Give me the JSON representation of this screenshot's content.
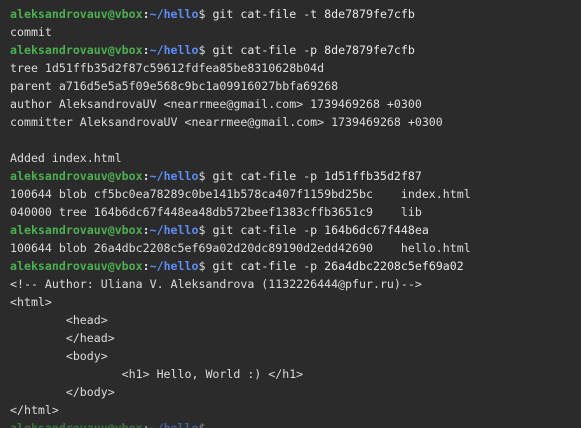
{
  "prompt": {
    "user_host": "aleksandrovauv@vbox",
    "colon": ":",
    "path": "~/hello",
    "dollar": "$ "
  },
  "lines": [
    {
      "type": "cmd",
      "text": "git cat-file -t 8de7879fe7cfb"
    },
    {
      "type": "out",
      "text": "commit"
    },
    {
      "type": "cmd",
      "text": "git cat-file -p 8de7879fe7cfb"
    },
    {
      "type": "out",
      "text": "tree 1d51ffb35d2f87c59612fdfea85be8310628b04d"
    },
    {
      "type": "out",
      "text": "parent a716d5e5a5f09e568c9bc1a09916027bbfa69268"
    },
    {
      "type": "out",
      "text": "author AleksandrovaUV <nearrmee@gmail.com> 1739469268 +0300"
    },
    {
      "type": "out",
      "text": "committer AleksandrovaUV <nearrmee@gmail.com> 1739469268 +0300"
    },
    {
      "type": "out",
      "text": ""
    },
    {
      "type": "out",
      "text": "Added index.html"
    },
    {
      "type": "cmd",
      "text": "git cat-file -p 1d51ffb35d2f87"
    },
    {
      "type": "out",
      "text": "100644 blob cf5bc0ea78289c0be141b578ca407f1159bd25bc    index.html"
    },
    {
      "type": "out",
      "text": "040000 tree 164b6dc67f448ea48db572beef1383cffb3651c9    lib"
    },
    {
      "type": "cmd",
      "text": "git cat-file -p 164b6dc67f448ea"
    },
    {
      "type": "out",
      "text": "100644 blob 26a4dbc2208c5ef69a02d20dc89190d2edd42690    hello.html"
    },
    {
      "type": "cmd",
      "text": "git cat-file -p 26a4dbc2208c5ef69a02"
    },
    {
      "type": "out",
      "text": "<!-- Author: Uliana V. Aleksandrova (1132226444@pfur.ru)-->"
    },
    {
      "type": "out",
      "text": "<html>"
    },
    {
      "type": "out",
      "text": "        <head>"
    },
    {
      "type": "out",
      "text": "        </head>"
    },
    {
      "type": "out",
      "text": "        <body>"
    },
    {
      "type": "out",
      "text": "                <h1> Hello, World :) </h1>"
    },
    {
      "type": "out",
      "text": "        </body>"
    },
    {
      "type": "out",
      "text": "</html>"
    },
    {
      "type": "cmd",
      "text": "",
      "partial": true
    }
  ]
}
